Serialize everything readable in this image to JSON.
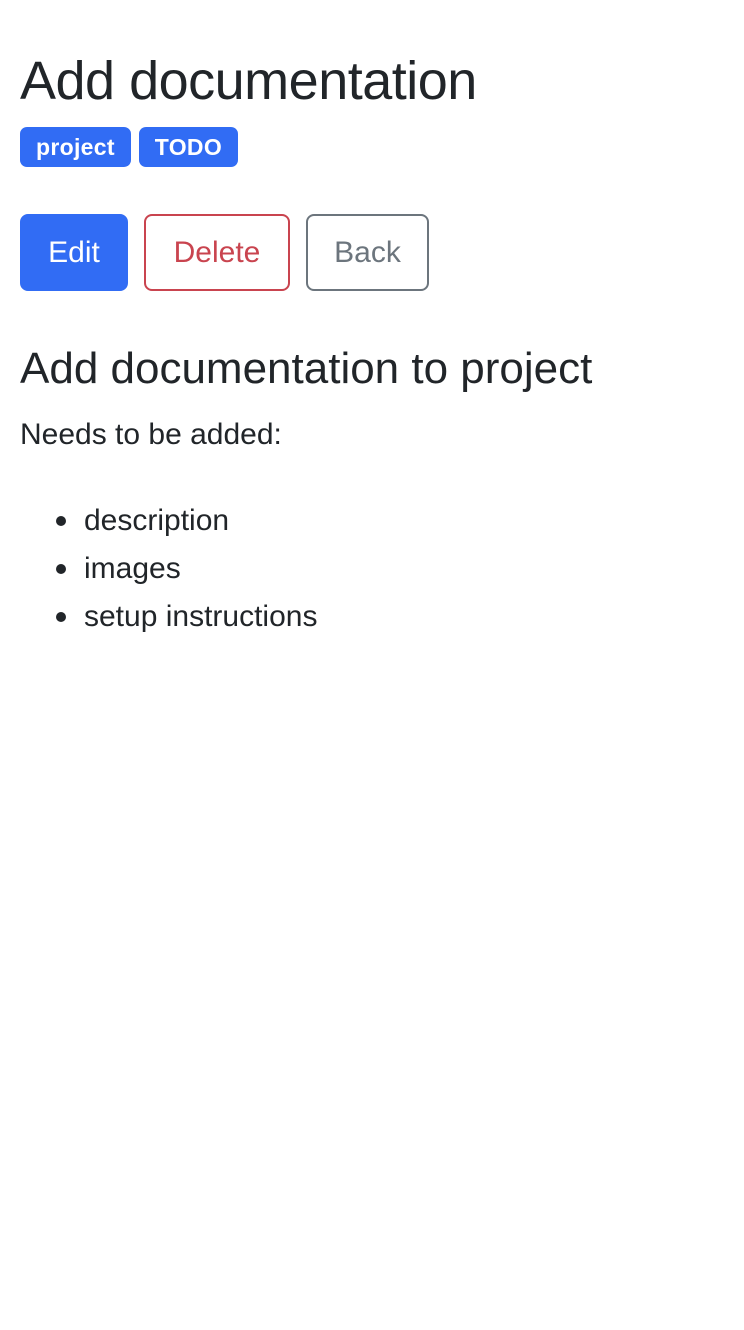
{
  "page": {
    "title": "Add documentation"
  },
  "tags": [
    {
      "label": "project"
    },
    {
      "label": "TODO"
    }
  ],
  "actions": {
    "edit_label": "Edit",
    "delete_label": "Delete",
    "back_label": "Back"
  },
  "content": {
    "heading": "Add documentation to project",
    "intro": "Needs to be added:",
    "items": [
      "description",
      "images",
      "setup instructions"
    ]
  },
  "colors": {
    "primary": "#316cf4",
    "danger": "#c9444f",
    "secondary": "#6c757d",
    "text": "#212529"
  }
}
